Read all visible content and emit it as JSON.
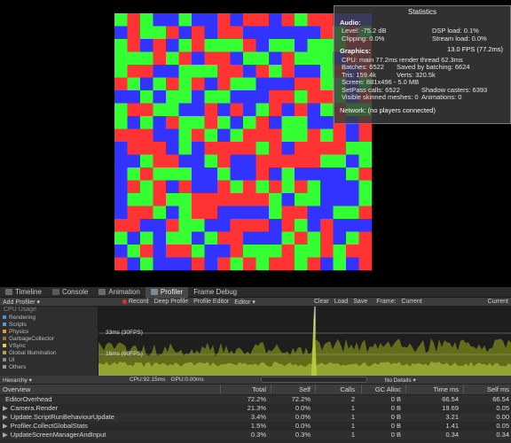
{
  "statistics": {
    "title": "Statistics",
    "audio_header": "Audio:",
    "level": "Level: -75.2 dB",
    "dsp_load": "DSP load: 0.1%",
    "clipping": "Clipping: 0.0%",
    "stream_load": "Stream load: 0.0%",
    "graphics_header": "Graphics:",
    "fps": "13.0 FPS (77.2ms)",
    "cpu": "CPU: main 77.2ms  render thread 62.3ms",
    "batches": "Batches: 6522",
    "saved_batching": "Saved by batching: 6624",
    "tris": "Tris: 159.4k",
    "verts": "Verts: 320.5k",
    "screen": "Screen: 881x496 - 5.0 MB",
    "setpass": "SetPass calls: 6522",
    "shadow_casters": "Shadow casters: 6393",
    "skinned": "Visible skinned meshes: 0",
    "animations": "Animations: 0",
    "network": "Network: (no players connected)"
  },
  "tabs": [
    {
      "label": "Timeline",
      "icon": "timeline-icon"
    },
    {
      "label": "Console",
      "icon": "console-icon"
    },
    {
      "label": "Animation",
      "icon": "animation-icon"
    },
    {
      "label": "Profiler",
      "icon": "profiler-icon"
    },
    {
      "label": "Frame Debug",
      "icon": "frame-debug-icon"
    }
  ],
  "toolbar": {
    "add_profiler": "Add Profiler",
    "record": "Record",
    "deep_profile": "Deep Profile",
    "profile_editor": "Profile Editor",
    "editor": "Editor",
    "clear": "Clear",
    "load": "Load",
    "save": "Save",
    "frame_label": "Frame:",
    "frame_value": "Current",
    "current_btn": "Current"
  },
  "cpu_module": {
    "title": "CPU Usage",
    "categories": [
      {
        "label": "Rendering",
        "color": "#4c8fd6"
      },
      {
        "label": "Scripts",
        "color": "#4c9fd6"
      },
      {
        "label": "Physics",
        "color": "#e0a030"
      },
      {
        "label": "GarbageCollector",
        "color": "#8a7a3a"
      },
      {
        "label": "VSync",
        "color": "#e6d23a"
      },
      {
        "label": "Global Illumination",
        "color": "#c0a040"
      },
      {
        "label": "UI",
        "color": "#888888"
      },
      {
        "label": "Others",
        "color": "#999999"
      }
    ],
    "ms33": "33ms (30FPS)",
    "ms16": "16ms (60FPS)"
  },
  "info_bar": {
    "hierarchy": "Hierarchy",
    "cpu": "CPU:92.15ms",
    "gpu": "GPU:0.00ms",
    "details": "No Details"
  },
  "table": {
    "headers": [
      "Overview",
      "Total",
      "Self",
      "Calls",
      "GC Alloc",
      "Time ms",
      "Self ms"
    ],
    "rows": [
      [
        "EditorOverhead",
        "72.2%",
        "72.2%",
        "2",
        "0 B",
        "66.54",
        "66.54"
      ],
      [
        "Camera.Render",
        "21.3%",
        "0.0%",
        "1",
        "0 B",
        "19.69",
        "0.05"
      ],
      [
        "Update.ScriptRunBehaviourUpdate",
        "3.4%",
        "0.0%",
        "1",
        "0 B",
        "3.21",
        "0.00"
      ],
      [
        "Profiler.CollectGlobalStats",
        "1.5%",
        "0.0%",
        "1",
        "0 B",
        "1.41",
        "0.05"
      ],
      [
        "UpdateScreenManagerAndInput",
        "0.3%",
        "0.3%",
        "1",
        "0 B",
        "0.34",
        "0.34"
      ]
    ]
  },
  "colors": {
    "red": "#ff3333",
    "green": "#33ff33",
    "blue": "#3333ff",
    "panel": "#3c3c3c",
    "chart_fill": "#6e7a1a",
    "chart_line": "#b7c840",
    "vsync": "#e6d23a"
  }
}
